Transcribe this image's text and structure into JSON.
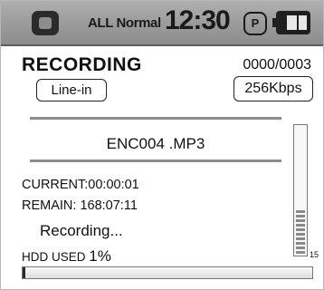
{
  "status_bar": {
    "hold_icon": "hold-lock-icon",
    "eq_mode": "ALL Normal",
    "time": "12:30",
    "play_mode_letter": "P",
    "battery_icon": "battery-icon"
  },
  "recording": {
    "title": "RECORDING",
    "counter": "0000/0003",
    "source": "Line-in",
    "bitrate": "256Kbps",
    "filename": "ENC004 .MP3",
    "current": "CURRENT:00:00:01",
    "remain": "REMAIN: 168:07:11",
    "status": "Recording..."
  },
  "storage": {
    "label": "HDD USED",
    "used_percent_text": "1%",
    "used_fraction": 0.01
  },
  "level_meter": {
    "value": "15",
    "lit_segments": 10
  }
}
